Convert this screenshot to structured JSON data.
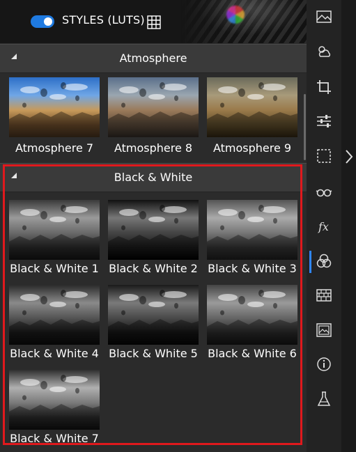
{
  "header": {
    "styles_label": "STYLES (LUTS)",
    "toggle_on": true,
    "toggle_color": "#1f7ae0"
  },
  "groups": [
    {
      "title": "Atmosphere",
      "items": [
        {
          "label": "Atmosphere 7",
          "tone": "color"
        },
        {
          "label": "Atmosphere 8",
          "tone": "warm"
        },
        {
          "label": "Atmosphere 9",
          "tone": "warm2"
        }
      ]
    },
    {
      "title": "Black & White",
      "items": [
        {
          "label": "Black & White 1",
          "tone": "bw1"
        },
        {
          "label": "Black & White 2",
          "tone": "bw2"
        },
        {
          "label": "Black & White 3",
          "tone": "bw3"
        },
        {
          "label": "Black & White 4",
          "tone": "bw4"
        },
        {
          "label": "Black & White 5",
          "tone": "bw5"
        },
        {
          "label": "Black & White 6",
          "tone": "bw6"
        },
        {
          "label": "Black & White 7",
          "tone": "bw7"
        }
      ]
    }
  ],
  "toolbar": [
    "landscape-icon",
    "weather-icon",
    "crop-icon",
    "sliders-icon",
    "selection-icon",
    "glasses-icon",
    "fx-icon",
    "color-circles-icon",
    "texture-icon",
    "image-icon",
    "info-icon",
    "flask-icon"
  ],
  "colors": {
    "selection": "#e0191d",
    "accent": "#2f86ff"
  }
}
